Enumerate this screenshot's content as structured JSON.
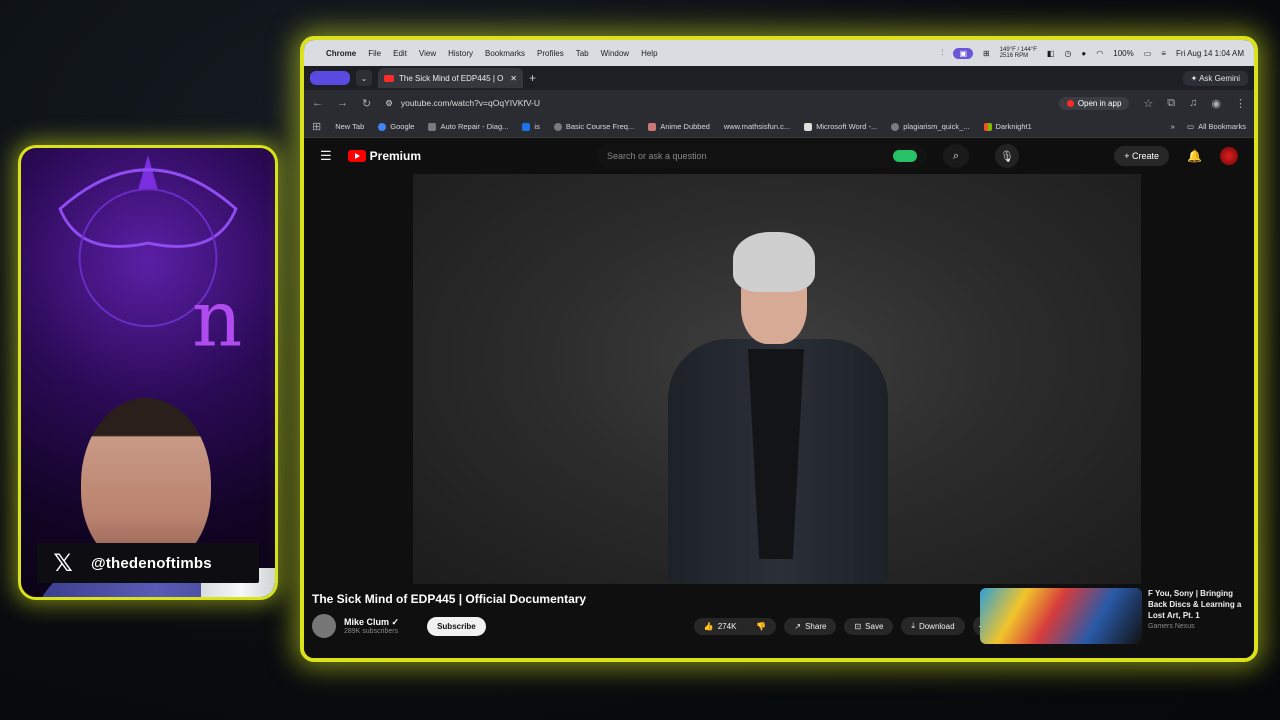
{
  "overlay": {
    "handle": "@thedenoftimbs",
    "x_icon": "x-logo-icon",
    "accent_color": "#d9e21a"
  },
  "menubar": {
    "app": "Chrome",
    "items": [
      "File",
      "Edit",
      "View",
      "History",
      "Bookmarks",
      "Profiles",
      "Tab",
      "Window",
      "Help"
    ],
    "weather": "149°F / 144°F",
    "rpm": "2516 RPM",
    "battery": "100%",
    "datetime": "Fri Aug 14  1:04 AM"
  },
  "tabbar": {
    "active_tab_title": "The Sick Mind of EDP445 | O",
    "gemini_label": "Ask Gemini"
  },
  "address": {
    "url": "youtube.com/watch?v=qOqYIVKfV-U",
    "open_in_app": "Open in app"
  },
  "bookmarks": [
    "New Tab",
    "Google",
    "Auto Repair - Diag...",
    "is",
    "Basic Course Freq...",
    "Anime Dubbed",
    "www.mathsisfun.c...",
    "Microsoft Word -...",
    "plagiarism_quick_...",
    "Darknight1"
  ],
  "bookmarks_all": "All Bookmarks",
  "youtube": {
    "logo_text": "Premium",
    "search_placeholder": "Search or ask a question",
    "create_label": "Create",
    "video_title": "The Sick Mind of EDP445 | Official Documentary",
    "channel_name": "Mike Clum",
    "subscribers": "289K subscribers",
    "subscribe_label": "Subscribe",
    "likes": "274K",
    "share_label": "Share",
    "save_label": "Save",
    "download_label": "Download",
    "rec_title": "F You, Sony | Bringing Back Discs & Learning a Lost Art, Pt. 1",
    "rec_channel": "Gamers Nexus"
  }
}
